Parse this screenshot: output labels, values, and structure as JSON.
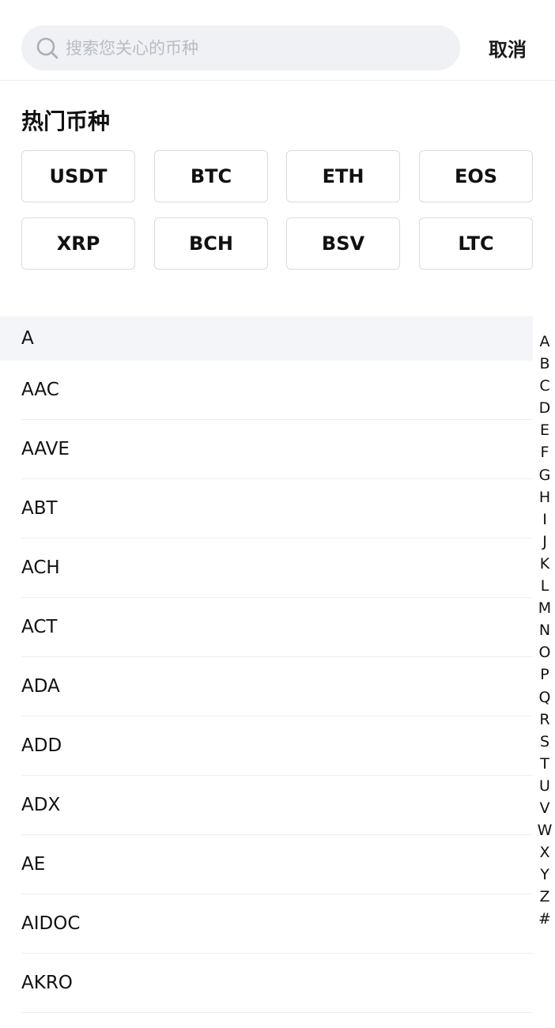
{
  "search": {
    "placeholder": "搜索您关心的币种",
    "value": ""
  },
  "cancel_label": "取消",
  "hot": {
    "title": "热门币种",
    "coins": [
      "USDT",
      "BTC",
      "ETH",
      "EOS",
      "XRP",
      "BCH",
      "BSV",
      "LTC"
    ]
  },
  "section_letter": "A",
  "coins": [
    "AAC",
    "AAVE",
    "ABT",
    "ACH",
    "ACT",
    "ADA",
    "ADD",
    "ADX",
    "AE",
    "AIDOC",
    "AKRO"
  ],
  "index_letters": [
    "A",
    "B",
    "C",
    "D",
    "E",
    "F",
    "G",
    "H",
    "I",
    "J",
    "K",
    "L",
    "M",
    "N",
    "O",
    "P",
    "Q",
    "R",
    "S",
    "T",
    "U",
    "V",
    "W",
    "X",
    "Y",
    "Z",
    "#"
  ],
  "colors": {
    "search_bg": "#eff1f4",
    "placeholder": "#b7bcc6",
    "section_bg": "#f4f5f8",
    "chip_border": "#d8dbe0"
  }
}
